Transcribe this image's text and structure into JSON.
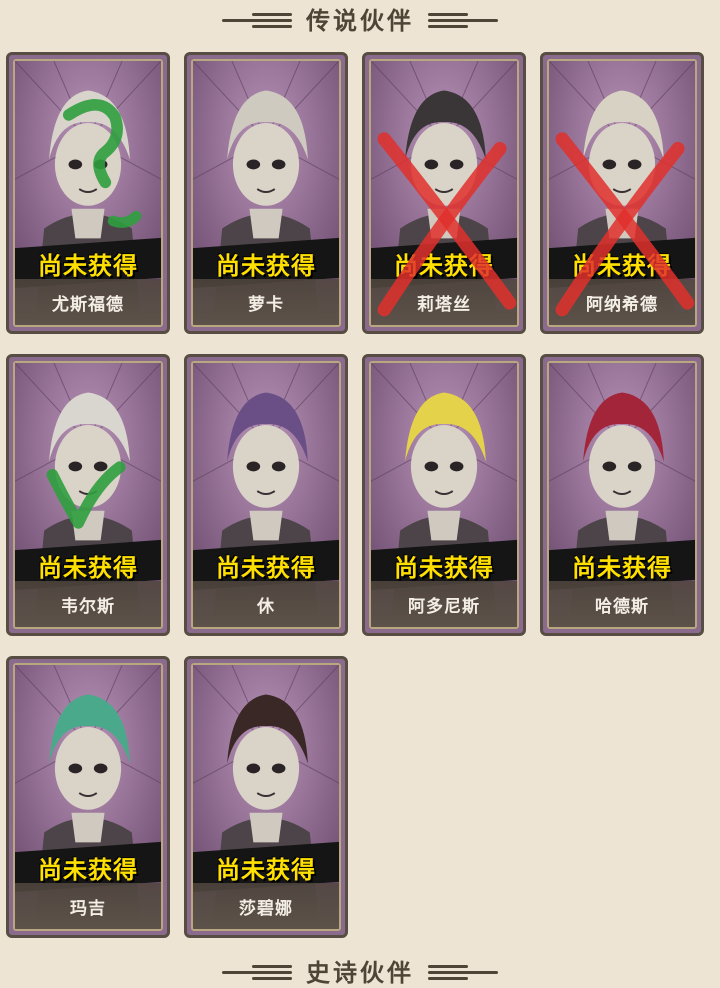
{
  "header": {
    "title": "传说伙伴"
  },
  "next_header": {
    "title": "史诗伙伴"
  },
  "colors": {
    "background": "#ede4d3",
    "card_purple": "#97749a",
    "status_yellow": "#ffe000",
    "mark_green": "#2f9e3e",
    "mark_red": "#e0302c"
  },
  "companions": [
    {
      "name": "尤斯福德",
      "status": "尚未获得",
      "mark": "question"
    },
    {
      "name": "萝卡",
      "status": "尚未获得",
      "mark": "none"
    },
    {
      "name": "莉塔丝",
      "status": "尚未获得",
      "mark": "cross"
    },
    {
      "name": "阿纳希德",
      "status": "尚未获得",
      "mark": "cross"
    },
    {
      "name": "韦尔斯",
      "status": "尚未获得",
      "mark": "check"
    },
    {
      "name": "休",
      "status": "尚未获得",
      "mark": "none"
    },
    {
      "name": "阿多尼斯",
      "status": "尚未获得",
      "mark": "none"
    },
    {
      "name": "哈德斯",
      "status": "尚未获得",
      "mark": "none"
    },
    {
      "name": "玛吉",
      "status": "尚未获得",
      "mark": "none"
    },
    {
      "name": "莎碧娜",
      "status": "尚未获得",
      "mark": "none"
    }
  ]
}
